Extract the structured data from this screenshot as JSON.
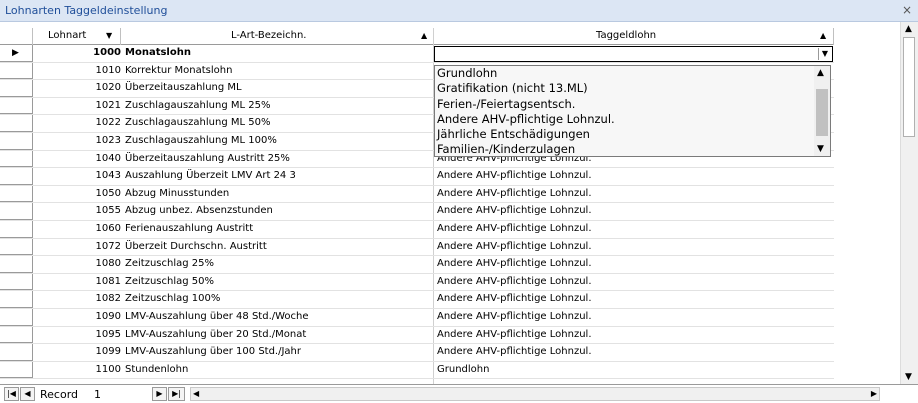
{
  "window": {
    "title": "Lohnarten Taggeldeinstellung",
    "close_glyph": "×"
  },
  "columns": {
    "code": "Lohnart",
    "name": "L-Art-Bezeichn.",
    "lohn": "Taggeldlohn"
  },
  "rows": [
    {
      "code": "1000",
      "name": "Monatslohn",
      "lohn": "",
      "bold": true
    },
    {
      "code": "1010",
      "name": "Korrektur Monatslohn",
      "lohn": ""
    },
    {
      "code": "1020",
      "name": "Überzeitauszahlung ML",
      "lohn": ""
    },
    {
      "code": "1021",
      "name": "Zuschlagauszahlung ML 25%",
      "lohn": ""
    },
    {
      "code": "1022",
      "name": "Zuschlagauszahlung ML 50%",
      "lohn": ""
    },
    {
      "code": "1023",
      "name": "Zuschlagauszahlung ML 100%",
      "lohn": ""
    },
    {
      "code": "1040",
      "name": "Überzeitauszahlung Austritt 25%",
      "lohn": "Andere AHV-pflichtige Lohnzul."
    },
    {
      "code": "1043",
      "name": "Auszahlung Überzeit LMV Art 24 3",
      "lohn": "Andere AHV-pflichtige Lohnzul."
    },
    {
      "code": "1050",
      "name": "Abzug Minusstunden",
      "lohn": "Andere AHV-pflichtige Lohnzul."
    },
    {
      "code": "1055",
      "name": "Abzug unbez. Absenzstunden",
      "lohn": "Andere AHV-pflichtige Lohnzul."
    },
    {
      "code": "1060",
      "name": "Ferienauszahlung Austritt",
      "lohn": "Andere AHV-pflichtige Lohnzul."
    },
    {
      "code": "1072",
      "name": "Überzeit Durchschn. Austritt",
      "lohn": "Andere AHV-pflichtige Lohnzul."
    },
    {
      "code": "1080",
      "name": "Zeitzuschlag 25%",
      "lohn": "Andere AHV-pflichtige Lohnzul."
    },
    {
      "code": "1081",
      "name": "Zeitzuschlag 50%",
      "lohn": "Andere AHV-pflichtige Lohnzul."
    },
    {
      "code": "1082",
      "name": "Zeitzuschlag 100%",
      "lohn": "Andere AHV-pflichtige Lohnzul."
    },
    {
      "code": "1090",
      "name": "LMV-Auszahlung über 48 Std./Woche",
      "lohn": "Andere AHV-pflichtige Lohnzul."
    },
    {
      "code": "1095",
      "name": "LMV-Auszahlung über 20 Std./Monat",
      "lohn": "Andere AHV-pflichtige Lohnzul."
    },
    {
      "code": "1099",
      "name": "LMV-Auszahlung über 100 Std./Jahr",
      "lohn": "Andere AHV-pflichtige Lohnzul."
    },
    {
      "code": "1100",
      "name": "Stundenlohn",
      "lohn": "Grundlohn"
    }
  ],
  "combo": {
    "value": ""
  },
  "dropdown_options": [
    "Grundlohn",
    "Gratifikation (nicht 13.ML)",
    "Ferien-/Feiertagsentsch.",
    "Andere AHV-pflichtige Lohnzul.",
    "Jährliche Entschädigungen",
    "Familien-/Kinderzulagen"
  ],
  "statusbar": {
    "label": "Record",
    "record_number": "1"
  },
  "icons": {
    "current_row": "▶",
    "sort_desc": "▼",
    "sort_asc": "▲",
    "combo_down": "▼",
    "scroll_up": "▲",
    "scroll_down": "▼",
    "first": "|◀",
    "prev": "◀",
    "next": "▶",
    "new": "▶|",
    "hscroll_left": "◀",
    "hscroll_right": "▶"
  }
}
